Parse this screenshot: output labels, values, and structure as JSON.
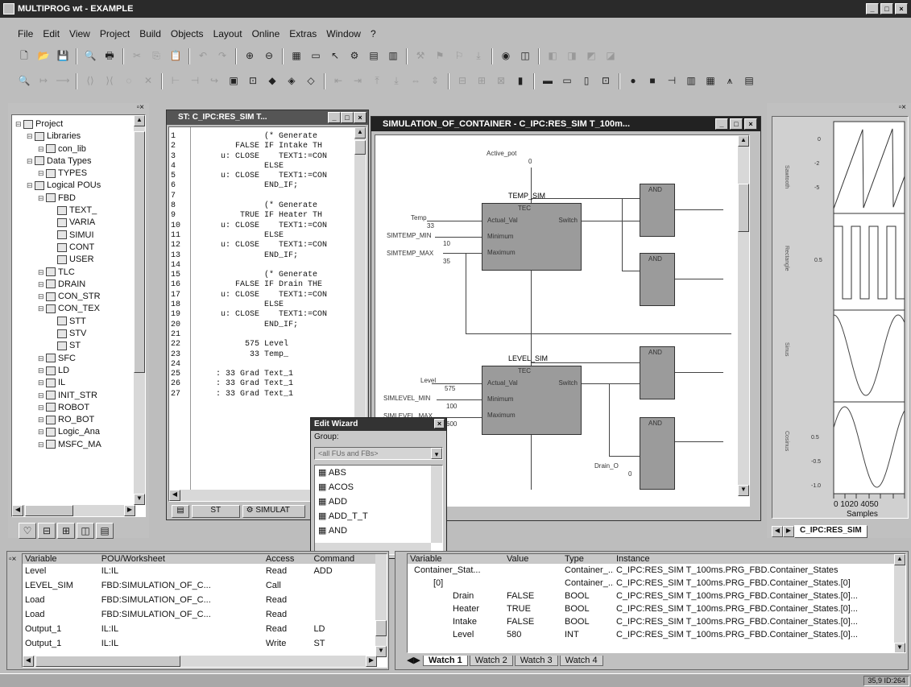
{
  "app": {
    "title": "MULTIPROG wt - EXAMPLE"
  },
  "menu": [
    "File",
    "Edit",
    "View",
    "Project",
    "Build",
    "Objects",
    "Layout",
    "Online",
    "Extras",
    "Window",
    "?"
  ],
  "tree": {
    "items": [
      {
        "label": "Project",
        "indent": 0
      },
      {
        "label": "Libraries",
        "indent": 1
      },
      {
        "label": "con_lib",
        "indent": 2
      },
      {
        "label": "Data Types",
        "indent": 1
      },
      {
        "label": "TYPES",
        "indent": 2
      },
      {
        "label": "Logical POUs",
        "indent": 1
      },
      {
        "label": "FBD",
        "indent": 2
      },
      {
        "label": "TEXT_",
        "indent": 3
      },
      {
        "label": "VARIA",
        "indent": 3
      },
      {
        "label": "SIMUI",
        "indent": 3
      },
      {
        "label": "CONT",
        "indent": 3
      },
      {
        "label": "USER",
        "indent": 3
      },
      {
        "label": "TLC",
        "indent": 2
      },
      {
        "label": "DRAIN",
        "indent": 2
      },
      {
        "label": "CON_STR",
        "indent": 2
      },
      {
        "label": "CON_TEX",
        "indent": 2
      },
      {
        "label": "STT",
        "indent": 3
      },
      {
        "label": "STV",
        "indent": 3
      },
      {
        "label": "ST",
        "indent": 3
      },
      {
        "label": "SFC",
        "indent": 2
      },
      {
        "label": "LD",
        "indent": 2
      },
      {
        "label": "IL",
        "indent": 2
      },
      {
        "label": "INIT_STR",
        "indent": 2
      },
      {
        "label": "ROBOT",
        "indent": 2
      },
      {
        "label": "RO_BOT",
        "indent": 2
      },
      {
        "label": "Logic_Ana",
        "indent": 2
      },
      {
        "label": "MSFC_MA",
        "indent": 2
      }
    ]
  },
  "st_window": {
    "title": "ST: C_IPC:RES_SIM T...",
    "tab_icon": "ST",
    "tab_label": "SIMULAT",
    "lines": [
      {
        "n": "1",
        "v": "",
        "c": "(* Generate"
      },
      {
        "n": "2",
        "v": "FALSE",
        "c": "IF Intake TH"
      },
      {
        "n": "3",
        "v": "u: CLOSE",
        "c": "   TEXT1:=CON"
      },
      {
        "n": "4",
        "v": "",
        "c": "ELSE"
      },
      {
        "n": "5",
        "v": "u: CLOSE",
        "c": "   TEXT1:=CON"
      },
      {
        "n": "6",
        "v": "",
        "c": "END_IF;"
      },
      {
        "n": "7",
        "v": "",
        "c": ""
      },
      {
        "n": "8",
        "v": "",
        "c": "(* Generate"
      },
      {
        "n": "9",
        "v": "TRUE",
        "c": "IF Heater TH"
      },
      {
        "n": "10",
        "v": "u: CLOSE",
        "c": "   TEXT1:=CON"
      },
      {
        "n": "11",
        "v": "",
        "c": "ELSE"
      },
      {
        "n": "12",
        "v": "u: CLOSE",
        "c": "   TEXT1:=CON"
      },
      {
        "n": "13",
        "v": "",
        "c": "END_IF;"
      },
      {
        "n": "14",
        "v": "",
        "c": ""
      },
      {
        "n": "15",
        "v": "",
        "c": "(* Generate"
      },
      {
        "n": "16",
        "v": "FALSE",
        "c": "IF Drain THE"
      },
      {
        "n": "17",
        "v": "u: CLOSE",
        "c": "   TEXT1:=CON"
      },
      {
        "n": "18",
        "v": "",
        "c": "ELSE"
      },
      {
        "n": "19",
        "v": "u: CLOSE",
        "c": "   TEXT1:=CON"
      },
      {
        "n": "20",
        "v": "",
        "c": "END_IF;"
      },
      {
        "n": "21",
        "v": "",
        "c": ""
      },
      {
        "n": "22",
        "v": "575",
        "c": "Level"
      },
      {
        "n": "23",
        "v": "33",
        "c": "Temp_"
      },
      {
        "n": "24",
        "v": "",
        "c": ""
      },
      {
        "n": "25",
        "v": ": 33 Grad",
        "c": "Text_1"
      },
      {
        "n": "26",
        "v": ": 33 Grad",
        "c": "Text_1"
      },
      {
        "n": "27",
        "v": ": 33 Grad",
        "c": "Text_1"
      }
    ]
  },
  "fbd_window": {
    "title": "SIMULATION_OF_CONTAINER - C_IPC:RES_SIM T_100m...",
    "blocks": {
      "temp": {
        "name": "TEMP_SIM",
        "type": "TEC",
        "in1": "Actual_Val",
        "in2": "Minimum",
        "in3": "Maximum",
        "out": "Switch"
      },
      "level": {
        "name": "LEVEL_SIM",
        "type": "TEC",
        "in1": "Actual_Val",
        "in2": "Minimum",
        "in3": "Maximum",
        "out": "Switch"
      },
      "and1": "AND",
      "and2": "AND",
      "and3": "AND",
      "and4": "AND"
    },
    "labels": {
      "active_pot": "Active_pot",
      "active_pot_val": "0",
      "temp": "Temp",
      "temp_val": "33",
      "sim_min": "SIMTEMP_MIN",
      "sim_min_val": "10",
      "sim_max": "SIMTEMP_MAX",
      "sim_max_val": "35",
      "level": "Level",
      "level_val": "575",
      "sim_lmin": "SIMLEVEL_MIN",
      "sim_lmin_val": "100",
      "sim_lmax": "SIMLEVEL_MAX",
      "sim_lmax_val": "600",
      "drain": "Drain_O",
      "drain_val": "0"
    }
  },
  "edit_wizard": {
    "title": "Edit Wizard",
    "group_label": "Group:",
    "group_value": "<all FUs and FBs>",
    "items": [
      "ABS",
      "ACOS",
      "ADD",
      "ADD_T_T",
      "AND"
    ]
  },
  "scope": {
    "tab_label": "C_IPC:RES_SIM",
    "xlabel": "Samples",
    "ticks": [
      "0",
      "10",
      "20",
      "40",
      "50"
    ]
  },
  "xref": {
    "headers": [
      "Variable",
      "POU/Worksheet",
      "Access",
      "Command"
    ],
    "rows": [
      {
        "var": "Level",
        "pou": "IL:IL",
        "access": "Read",
        "cmd": "ADD"
      },
      {
        "var": "LEVEL_SIM",
        "pou": "FBD:SIMULATION_OF_C...",
        "access": "Call",
        "cmd": ""
      },
      {
        "var": "Load",
        "pou": "FBD:SIMULATION_OF_C...",
        "access": "Read",
        "cmd": ""
      },
      {
        "var": "Load",
        "pou": "FBD:SIMULATION_OF_C...",
        "access": "Read",
        "cmd": ""
      },
      {
        "var": "Output_1",
        "pou": "IL:IL",
        "access": "Read",
        "cmd": "LD"
      },
      {
        "var": "Output_1",
        "pou": "IL:IL",
        "access": "Write",
        "cmd": "ST"
      }
    ]
  },
  "watch": {
    "headers": [
      "Variable",
      "Value",
      "Type",
      "Instance"
    ],
    "rows": [
      {
        "var": "Container_Stat...",
        "val": "",
        "type": "Container_...",
        "inst": "C_IPC:RES_SIM T_100ms.PRG_FBD.Container_States",
        "indent": 0
      },
      {
        "var": "[0]",
        "val": "",
        "type": "Container_...",
        "inst": "C_IPC:RES_SIM T_100ms.PRG_FBD.Container_States.[0]",
        "indent": 1
      },
      {
        "var": "Drain",
        "val": "FALSE",
        "type": "BOOL",
        "inst": "C_IPC:RES_SIM T_100ms.PRG_FBD.Container_States.[0]...",
        "indent": 2
      },
      {
        "var": "Heater",
        "val": "TRUE",
        "type": "BOOL",
        "inst": "C_IPC:RES_SIM T_100ms.PRG_FBD.Container_States.[0]...",
        "indent": 2
      },
      {
        "var": "Intake",
        "val": "FALSE",
        "type": "BOOL",
        "inst": "C_IPC:RES_SIM T_100ms.PRG_FBD.Container_States.[0]...",
        "indent": 2
      },
      {
        "var": "Level",
        "val": "580",
        "type": "INT",
        "inst": "C_IPC:RES_SIM T_100ms.PRG_FBD.Container_States.[0]...",
        "indent": 2
      }
    ],
    "tabs": [
      "Watch 1",
      "Watch 2",
      "Watch 3",
      "Watch 4"
    ]
  },
  "status": {
    "right": "35,9 ID:264"
  }
}
